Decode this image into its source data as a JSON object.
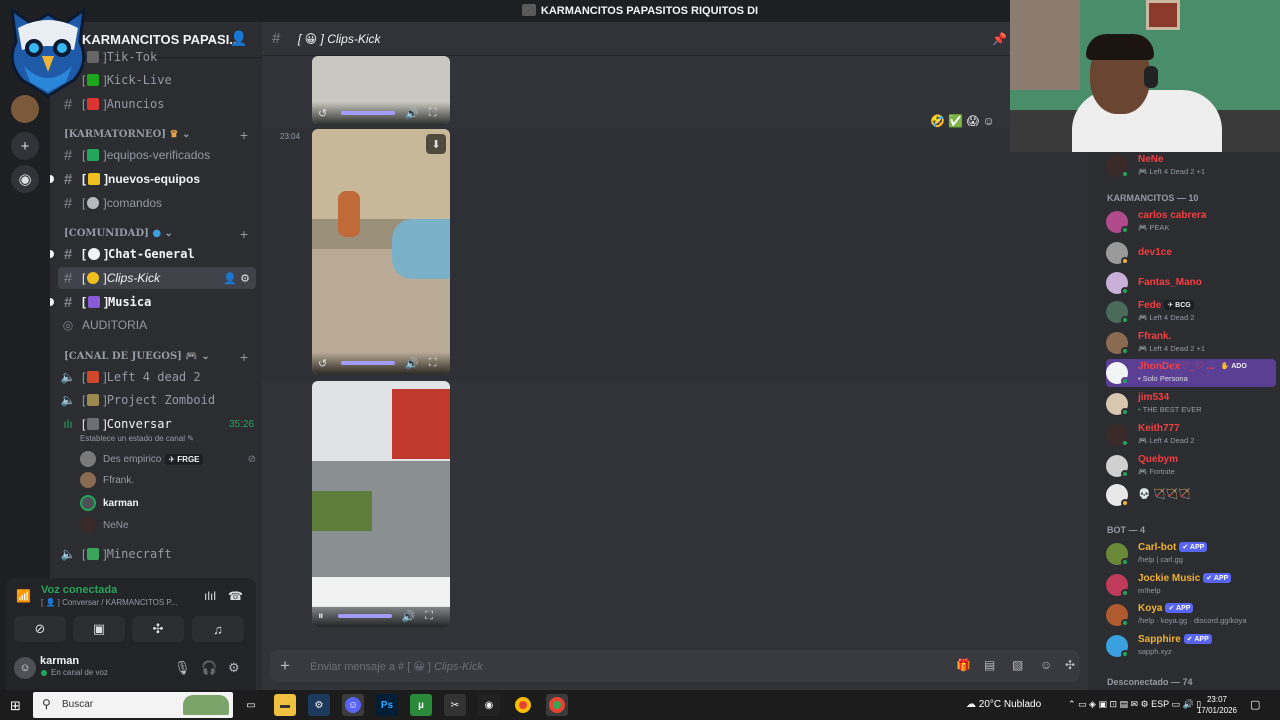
{
  "window": {
    "title": "KARMANCITOS PAPASITOS RIQUITOS DI"
  },
  "server": {
    "name": "KARMANCITOS PAPASI..."
  },
  "channels": {
    "tiktok": "Tik-Tok",
    "kick_live": "Kick-Live",
    "anuncios": "Anuncios",
    "cat_torneo": "[KARMATORNEO]",
    "equipos_verificados": "equipos-verificados",
    "nuevos_equipos": "nuevos-equipos",
    "comandos": "comandos",
    "cat_comunidad": "[COMUNIDAD]",
    "chat_general": "Chat-General",
    "clips_kick": "Clips-Kick",
    "musica": "Musica",
    "auditoria": "AUDITORIA",
    "cat_juegos": "[CANAL DE JUEGOS]",
    "left4dead": "Left 4 dead 2",
    "zomboid": "Project Zomboid",
    "conversar": "Conversar",
    "conversar_timer": "35:26",
    "conversar_status": "Establece un estado de canal",
    "minecraft": "Minecraft"
  },
  "voice_members": [
    {
      "name": "Des empirico",
      "tag": "FRGE"
    },
    {
      "name": "Ffrank."
    },
    {
      "name": "karman"
    },
    {
      "name": "NeNe"
    }
  ],
  "voice_panel": {
    "status": "Voz conectada",
    "location": "[ 👤 ] Conversar / KARMANCITOS P..."
  },
  "user_panel": {
    "name": "karman",
    "status": "En canal de voz"
  },
  "chat": {
    "channel_title": "Clips-Kick",
    "timestamp": "23:04",
    "composer_placeholder_prefix": "Enviar mensaje a #",
    "composer_placeholder_channel": "Clips-Kick"
  },
  "members": {
    "top": {
      "name": "NeNe",
      "activity": "Left 4 Dead 2 +1"
    },
    "group_karmancitos": "KARMANCITOS — 10",
    "list": [
      {
        "name": "carlos cabrera",
        "activity": "PEAK"
      },
      {
        "name": "dev1ce",
        "activity": ""
      },
      {
        "name": "Fantas_Mano",
        "activity": ""
      },
      {
        "name": "Fede",
        "tag": "BCG",
        "activity": "Left 4 Dead 2"
      },
      {
        "name": "Ffrank.",
        "activity": "Left 4 Dead 2 +1"
      },
      {
        "name": "JhonDex♡_♡ ...",
        "tag": "ADO",
        "activity": "Solo Persona"
      },
      {
        "name": "jim534",
        "activity": "THE BEST EVER"
      },
      {
        "name": "Keith777",
        "activity": "Left 4 Dead 2"
      },
      {
        "name": "Quebym",
        "activity": "Fortnite"
      },
      {
        "name": "",
        "activity": "💀 🏹🏹🏹"
      }
    ],
    "group_bot": "BOT — 4",
    "bots": [
      {
        "name": "Carl-bot",
        "tag": "APP",
        "activity": "/help | carl.gg"
      },
      {
        "name": "Jockie Music",
        "tag": "APP",
        "activity": "m!help"
      },
      {
        "name": "Koya",
        "tag": "APP",
        "activity": "/help · koya.gg · discord.gg/koya"
      },
      {
        "name": "Sapphire",
        "tag": "APP",
        "activity": "sapph.xyz"
      }
    ],
    "group_offline": "Desconectado — 74"
  },
  "taskbar": {
    "search_placeholder": "Buscar",
    "weather": "20°C  Nublado",
    "lang": "ESP",
    "time": "23:07",
    "date": "17/01/2026"
  },
  "colors": {
    "accent": "#5865f2",
    "online": "#23a55a",
    "member_red": "#f23f42",
    "bot_gold": "#f0b232"
  }
}
